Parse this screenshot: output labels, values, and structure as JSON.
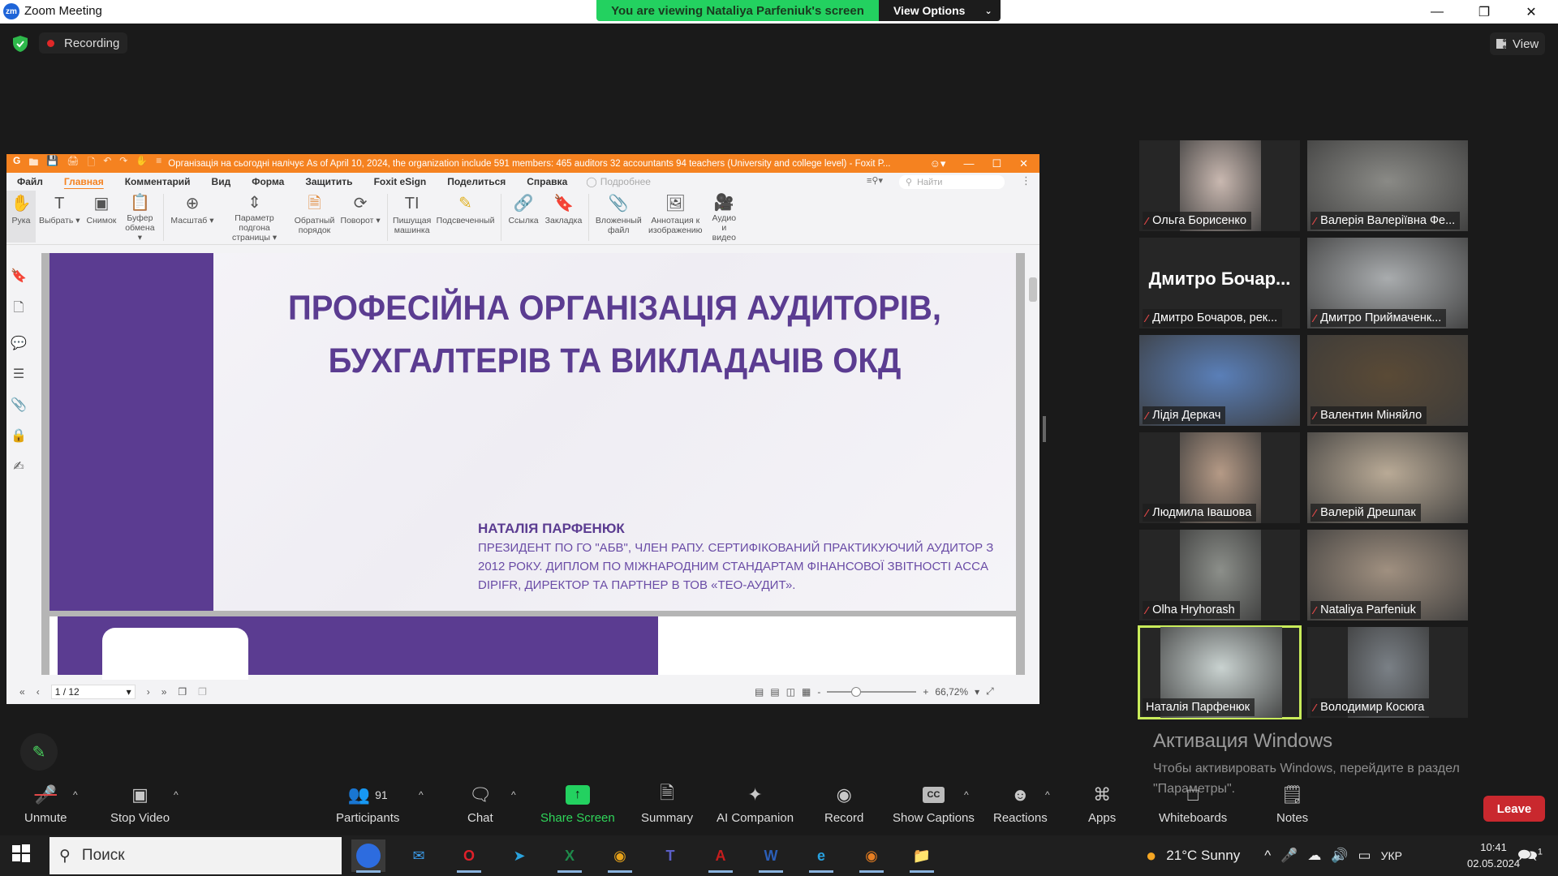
{
  "window": {
    "app_title": "Zoom Meeting",
    "logo_text": "zm"
  },
  "share_banner": {
    "text": "You are viewing Nataliya Parfeniuk's screen",
    "view_options": "View Options"
  },
  "meeting_bar": {
    "recording": "Recording",
    "view": "View"
  },
  "foxit": {
    "doc_title": "Організація на сьогодні налічує As of April 10, 2024, the organization include 591 members: 465 auditors 32 accountants 94 teachers (University and college level) - Foxit P...",
    "menu": [
      "Файл",
      "Главная",
      "Комментарий",
      "Вид",
      "Форма",
      "Защитить",
      "Foxit eSign",
      "Поделиться",
      "Справка"
    ],
    "active_menu": "Главная",
    "tell_me": "Подробнее",
    "search_placeholder": "Найти",
    "tools": [
      {
        "label": "Рука",
        "icon": "hand-icon"
      },
      {
        "label": "Выбрать ▾",
        "icon": "select-text-icon"
      },
      {
        "label": "Снимок",
        "icon": "snapshot-icon"
      },
      {
        "label": "Буфер обмена ▾",
        "icon": "clipboard-icon"
      },
      {
        "label": "Масштаб ▾",
        "icon": "zoom-in-icon"
      },
      {
        "label": "Параметр подгона страницы ▾",
        "icon": "fit-page-icon"
      },
      {
        "label": "Обратный порядок",
        "icon": "reverse-order-icon"
      },
      {
        "label": "Поворот ▾",
        "icon": "rotate-icon"
      },
      {
        "label": "Пишущая машинка",
        "icon": "typewriter-icon"
      },
      {
        "label": "Подсвеченный",
        "icon": "highlight-icon"
      },
      {
        "label": "Ссылка",
        "icon": "link-icon"
      },
      {
        "label": "Закладка",
        "icon": "bookmark-icon"
      },
      {
        "label": "Вложенный файл",
        "icon": "attachment-file-icon"
      },
      {
        "label": "Аннотация к изображению",
        "icon": "image-annotation-icon"
      },
      {
        "label": "Аудио и видео",
        "icon": "video-camera-icon"
      }
    ],
    "slide": {
      "title_line1": "ПРОФЕСІЙНА ОРГАНІЗАЦІЯ АУДИТОРІВ,",
      "title_line2": "БУХГАЛТЕРІВ ТА ВИКЛАДАЧІВ ОКД",
      "speaker_name": "НАТАЛІЯ ПАРФЕНЮК",
      "speaker_bio": "ПРЕЗИДЕНТ ПО ГО \"АБВ\", ЧЛЕН РАПУ. СЕРТИФІКОВАНИЙ ПРАКТИКУЮЧИЙ АУДИТОР З 2012 РОКУ. ДИПЛОМ ПО МІЖНАРОДНИМ СТАНДАРТАМ ФІНАНСОВОЇ ЗВІТНОСТІ ACCA DIPIFR, ДИРЕКТОР ТА ПАРТНЕР В ТОВ «ТЕО-АУДИТ»."
    },
    "status": {
      "page": "1 / 12",
      "zoom": "66,72%",
      "zoom_fraction": 0.33
    },
    "colors": {
      "accent": "#f58220",
      "slide_purple": "#5b3c91"
    }
  },
  "participants": [
    {
      "name": "Ольга Борисенко",
      "muted": true,
      "video": true,
      "bg": "#c9b8b0"
    },
    {
      "name": "Валерія Валеріївна Фе...",
      "muted": true,
      "video": true,
      "bg": "#8a8a86"
    },
    {
      "name": "Дмитро Бочаров, рек...",
      "muted": true,
      "video": false,
      "display": "Дмитро Бочар..."
    },
    {
      "name": "Дмитро Приймаченк...",
      "muted": true,
      "video": true,
      "bg": "#a9acae"
    },
    {
      "name": "Лідія Деркач",
      "muted": true,
      "video": true,
      "bg": "#5a7fb8"
    },
    {
      "name": "Валентин Міняйло",
      "muted": true,
      "video": true,
      "bg": "#5a4a36"
    },
    {
      "name": "Людмила Івашова",
      "muted": true,
      "video": true,
      "bg": "#b59a86"
    },
    {
      "name": "Валерій Дрешпак",
      "muted": true,
      "video": true,
      "bg": "#b9aa96"
    },
    {
      "name": "Olha Hryhorash",
      "muted": true,
      "video": true,
      "bg": "#8c8f8a"
    },
    {
      "name": "Nataliya Parfeniuk",
      "muted": true,
      "video": true,
      "bg": "#a09080"
    },
    {
      "name": "Наталія Парфенюк",
      "muted": false,
      "video": true,
      "active_speaker": true,
      "bg": "#c9d2d0"
    },
    {
      "name": "Володимир Косюга",
      "muted": true,
      "video": true,
      "bg": "#7a8086"
    }
  ],
  "windows_activation": {
    "title": "Активация Windows",
    "subtitle": "Чтобы активировать Windows, перейдите в раздел \"Параметры\"."
  },
  "toolbar": {
    "unmute": "Unmute",
    "stop_video": "Stop Video",
    "participants": "Participants",
    "participants_count": "91",
    "chat": "Chat",
    "share_screen": "Share Screen",
    "summary": "Summary",
    "ai_companion": "AI Companion",
    "record": "Record",
    "show_captions": "Show Captions",
    "captions_badge": "CC",
    "reactions": "Reactions",
    "apps": "Apps",
    "whiteboards": "Whiteboards",
    "notes": "Notes",
    "leave": "Leave"
  },
  "taskbar": {
    "search": "Поиск",
    "weather": "21°C  Sunny",
    "language": "УКР",
    "time": "10:41",
    "date": "02.05.2024",
    "notifications": "1",
    "apps": [
      "zoom",
      "mail",
      "opera",
      "telegram",
      "excel",
      "chrome",
      "teams",
      "acrobat",
      "word",
      "edge",
      "chrome-canary",
      "file-explorer"
    ]
  }
}
